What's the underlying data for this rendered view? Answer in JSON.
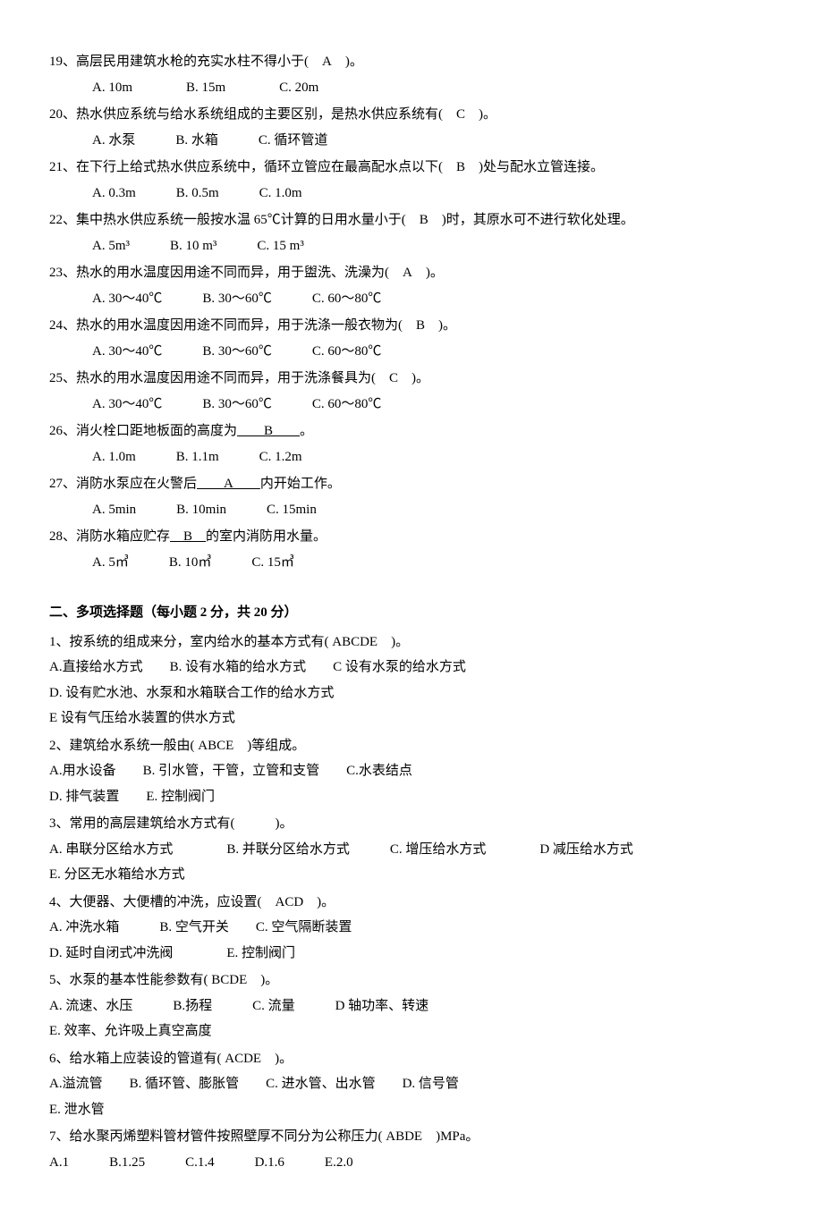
{
  "single_choice": [
    {
      "num": "19、",
      "text": "高层民用建筑水枪的充实水柱不得小于( A )。",
      "opts": "A. 10m    B. 15m    C. 20m"
    },
    {
      "num": "20、",
      "text": "热水供应系统与给水系统组成的主要区别，是热水供应系统有( C )。",
      "opts": "A. 水泵   B. 水箱   C. 循环管道"
    },
    {
      "num": "21、",
      "text": "在下行上给式热水供应系统中，循环立管应在最高配水点以下( B )处与配水立管连接。",
      "opts": "A. 0.3m   B. 0.5m   C. 1.0m"
    },
    {
      "num": "22、",
      "text": "集中热水供应系统一般按水温 65℃计算的日用水量小于( B )时，其原水可不进行软化处理。",
      "opts": "A. 5m³   B. 10 m³   C. 15 m³"
    },
    {
      "num": "23、",
      "text": "热水的用水温度因用途不同而异，用于盥洗、洗澡为( A )。",
      "opts": "A. 30～40℃   B. 30～60℃   C. 60～80℃"
    },
    {
      "num": "24、",
      "text": "热水的用水温度因用途不同而异，用于洗涤一般衣物为( B )。",
      "opts": "A. 30～40℃   B. 30～60℃   C. 60～80℃"
    },
    {
      "num": "25、",
      "text": "热水的用水温度因用途不同而异，用于洗涤餐具为( C )。",
      "opts": "A. 30～40℃   B. 30～60℃   C. 60～80℃"
    },
    {
      "num": "26、",
      "text_pre": "消火栓口距地板面的高度为",
      "text_u": "  B  ",
      "text_post": "。",
      "opts": "A. 1.0m   B. 1.1m   C. 1.2m"
    },
    {
      "num": "27、",
      "text_pre": "消防水泵应在火警后",
      "text_u": "  A  ",
      "text_post": "内开始工作。",
      "opts": "A. 5min   B. 10min   C. 15min"
    },
    {
      "num": "28、",
      "text_pre": "消防水箱应贮存",
      "text_u": " B ",
      "text_post": "的室内消防用水量。",
      "opts": "A. 5㎥   B. 10㎥   C. 15㎥"
    }
  ],
  "section2_header": "二、多项选择题（每小题 2 分，共 20 分）",
  "multi_choice": [
    {
      "lines": [
        "1、按系统的组成来分，室内给水的基本方式有( ABCDE )。",
        "A.直接给水方式  B. 设有水箱的给水方式  C 设有水泵的给水方式",
        "D. 设有贮水池、水泵和水箱联合工作的给水方式",
        "E 设有气压给水装置的供水方式"
      ]
    },
    {
      "lines": [
        "2、建筑给水系统一般由( ABCE )等组成。",
        "A.用水设备  B. 引水管，干管，立管和支管  C.水表结点",
        " D. 排气装置  E. 控制阀门"
      ]
    },
    {
      "lines": [
        "3、常用的高层建筑给水方式有(   )。",
        "A. 串联分区给水方式    B. 并联分区给水方式   C. 增压给水方式    D 减压给水方式",
        "E. 分区无水箱给水方式"
      ]
    },
    {
      "lines": [
        "4、大便器、大便槽的冲洗，应设置( ACD )。",
        "A. 冲洗水箱   B. 空气开关  C. 空气隔断装置",
        "D. 延时自闭式冲洗阀    E. 控制阀门"
      ]
    },
    {
      "lines": [
        "5、水泵的基本性能参数有( BCDE )。",
        "A. 流速、水压   B.扬程   C. 流量   D 轴功率、转速",
        "E. 效率、允许吸上真空高度"
      ]
    },
    {
      "lines": [
        "6、给水箱上应装设的管道有( ACDE )。",
        "A.溢流管  B. 循环管、膨胀管  C. 进水管、出水管  D. 信号管",
        "E. 泄水管"
      ]
    },
    {
      "lines": [
        "7、给水聚丙烯塑料管材管件按照壁厚不同分为公称压力( ABDE )MPa。",
        "A.1   B.1.25   C.1.4   D.1.6   E.2.0"
      ]
    }
  ]
}
